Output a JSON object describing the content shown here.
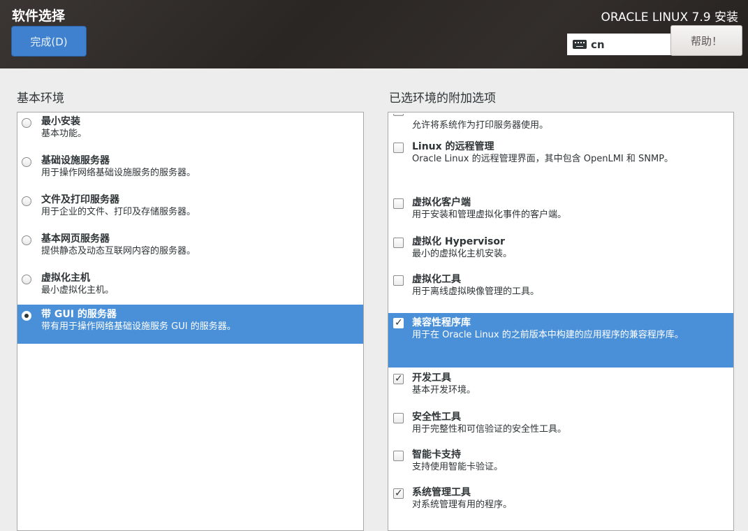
{
  "header": {
    "title": "软件选择",
    "done_label": "完成(D)",
    "product": "ORACLE LINUX 7.9 安装",
    "keyboard_layout": "cn",
    "help_label": "帮助！"
  },
  "left": {
    "label": "基本环境",
    "items": [
      {
        "name": "最小安装",
        "desc": "基本功能。",
        "selected": false
      },
      {
        "name": "基础设施服务器",
        "desc": "用于操作网络基础设施服务的服务器。",
        "selected": false
      },
      {
        "name": "文件及打印服务器",
        "desc": "用于企业的文件、打印及存储服务器。",
        "selected": false
      },
      {
        "name": "基本网页服务器",
        "desc": "提供静态及动态互联网内容的服务器。",
        "selected": false
      },
      {
        "name": "虚拟化主机",
        "desc": "最小虚拟化主机。",
        "selected": false
      },
      {
        "name": "带 GUI 的服务器",
        "desc": "带有用于操作网络基础设施服务 GUI 的服务器。",
        "selected": true
      }
    ]
  },
  "right": {
    "label": "已选环境的附加选项",
    "partial_desc": "允许将系统作为打印服务器使用。",
    "items": [
      {
        "name": "Linux 的远程管理",
        "desc": "Oracle Linux 的远程管理界面，其中包含 OpenLMI 和 SNMP。",
        "checked": false,
        "selected": false
      },
      {
        "name": "虚拟化客户端",
        "desc": "用于安装和管理虚拟化事件的客户端。",
        "checked": false,
        "selected": false
      },
      {
        "name": "虚拟化 Hypervisor",
        "desc": "最小的虚拟化主机安装。",
        "checked": false,
        "selected": false
      },
      {
        "name": "虚拟化工具",
        "desc": "用于离线虚拟映像管理的工具。",
        "checked": false,
        "selected": false
      },
      {
        "name": "兼容性程序库",
        "desc": "用于在 Oracle Linux 的之前版本中构建的应用程序的兼容程序库。",
        "checked": true,
        "selected": true
      },
      {
        "name": "开发工具",
        "desc": "基本开发环境。",
        "checked": true,
        "selected": false
      },
      {
        "name": "安全性工具",
        "desc": "用于完整性和可信验证的安全性工具。",
        "checked": false,
        "selected": false
      },
      {
        "name": "智能卡支持",
        "desc": "支持使用智能卡验证。",
        "checked": false,
        "selected": false
      },
      {
        "name": "系统管理工具",
        "desc": "对系统管理有用的程序。",
        "checked": true,
        "selected": false
      }
    ]
  }
}
